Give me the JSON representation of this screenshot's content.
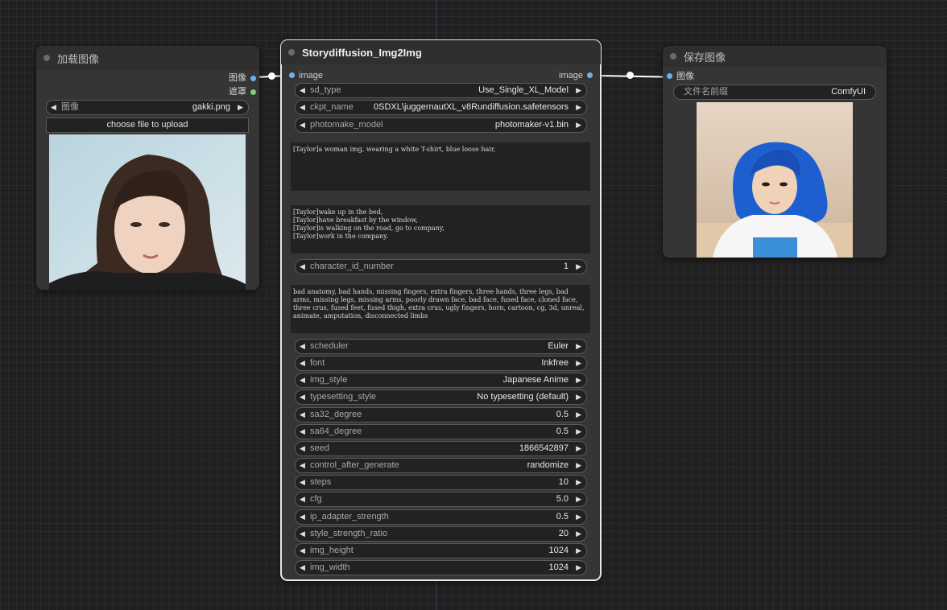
{
  "load_node": {
    "title": "加载图像",
    "outputs": [
      "图像",
      "遮罩"
    ],
    "image_widget": {
      "label": "图像",
      "value": "gakki.png"
    },
    "upload_button": "choose file to upload"
  },
  "main_node": {
    "title": "Storydiffusion_Img2Img",
    "input": "image",
    "output": "image",
    "combo": [
      {
        "label": "sd_type",
        "value": "Use_Single_XL_Model"
      },
      {
        "label": "ckpt_name",
        "value": "0SDXL\\juggernautXL_v8Rundiffusion.safetensors"
      },
      {
        "label": "photomake_model",
        "value": "photomaker-v1.bin"
      }
    ],
    "character_prompt": "[Taylor]a woman img, wearing a white T-shirt, blue loose hair,",
    "scene_prompt": "[Taylor]wake up in the bed,\n[Taylor]have breakfast by the window,\n[Taylor]is walking on the road, go to company,\n[Taylor]work in the company.",
    "character_id": {
      "label": "character_id_number",
      "value": "1"
    },
    "negative_prompt": "bad anatomy, bad hands, missing fingers, extra fingers, three hands, three legs, bad arms, missing legs, missing arms, poorly drawn face, bad face, fused face, cloned face, three crus, fused feet, fused thigh, extra crus, ugly fingers, horn, cartoon, cg, 3d, unreal, animate, amputation, disconnected limbs",
    "settings": [
      {
        "label": "scheduler",
        "value": "Euler"
      },
      {
        "label": "font",
        "value": "Inkfree"
      },
      {
        "label": "img_style",
        "value": "Japanese Anime"
      },
      {
        "label": "typesetting_style",
        "value": "No typesetting (default)"
      },
      {
        "label": "sa32_degree",
        "value": "0.5"
      },
      {
        "label": "sa64_degree",
        "value": "0.5"
      },
      {
        "label": "seed",
        "value": "1866542897"
      },
      {
        "label": "control_after_generate",
        "value": "randomize"
      },
      {
        "label": "steps",
        "value": "10"
      },
      {
        "label": "cfg",
        "value": "5.0"
      },
      {
        "label": "ip_adapter_strength",
        "value": "0.5"
      },
      {
        "label": "style_strength_ratio",
        "value": "20"
      },
      {
        "label": "img_height",
        "value": "1024"
      },
      {
        "label": "img_width",
        "value": "1024"
      }
    ]
  },
  "save_node": {
    "title": "保存图像",
    "input": "图像",
    "prefix_widget": {
      "label": "文件名前缀",
      "value": "ComfyUI"
    }
  },
  "colors": {
    "canvas": "#202020",
    "node_body": "#353535",
    "port_image": "#6fb2f0",
    "port_mask": "#7ccf7c",
    "link": "#ffffff"
  }
}
